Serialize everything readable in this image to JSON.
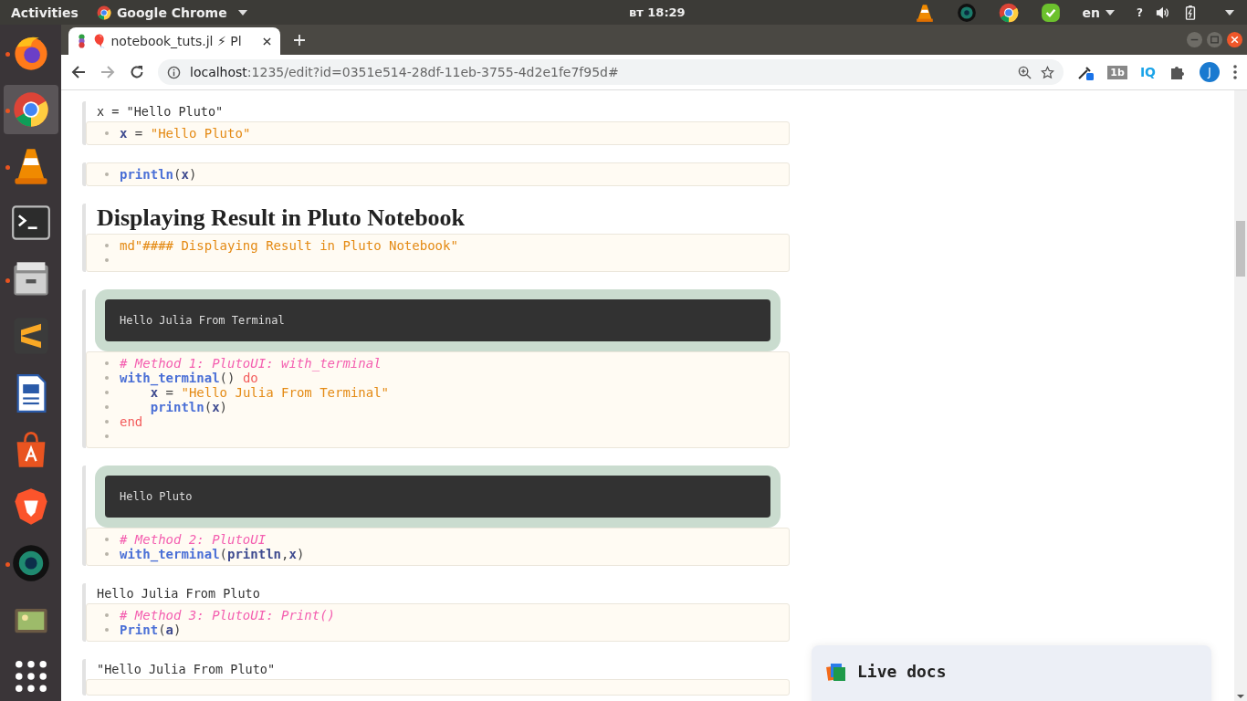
{
  "top_bar": {
    "activities": "Activities",
    "app_menu": "Google Chrome",
    "clock": "вт 18:29",
    "language": "en",
    "help": "?"
  },
  "dock": [
    {
      "kind": "firefox",
      "running": true,
      "selected": false
    },
    {
      "kind": "chrome",
      "running": true,
      "selected": true
    },
    {
      "kind": "vlc",
      "running": true,
      "selected": false
    },
    {
      "kind": "terminal",
      "running": false,
      "selected": false
    },
    {
      "kind": "files",
      "running": true,
      "selected": false
    },
    {
      "kind": "sublime",
      "running": false,
      "selected": false
    },
    {
      "kind": "writer",
      "running": false,
      "selected": false
    },
    {
      "kind": "store",
      "running": false,
      "selected": false
    },
    {
      "kind": "brave",
      "running": false,
      "selected": false
    },
    {
      "kind": "camera",
      "running": true,
      "selected": false
    },
    {
      "kind": "photos",
      "running": false,
      "selected": false
    },
    {
      "kind": "apps",
      "running": false,
      "selected": false
    }
  ],
  "browser": {
    "tab_title": "🎈 notebook_tuts.jl ⚡ Pl",
    "url_host": "localhost",
    "url_rest": ":1235/edit?id=0351e514-28df-11eb-3755-4d2e1fe7f95d#",
    "extension_labels": [
      "1b",
      "IQ"
    ],
    "avatar": "J"
  },
  "cells": [
    {
      "output": {
        "kind": "text",
        "text": "x = \"Hello Pluto\""
      },
      "lines": [
        {
          "kind": "code",
          "tokens": [
            {
              "text": "x",
              "kind": "var"
            },
            {
              "text": " = ",
              "kind": "op"
            },
            {
              "text": "\"Hello Pluto\"",
              "kind": "str"
            }
          ]
        }
      ]
    },
    {
      "output": {
        "kind": "none"
      },
      "lines": [
        {
          "kind": "code",
          "tokens": [
            {
              "text": "println",
              "kind": "func"
            },
            {
              "text": "(",
              "kind": "punc"
            },
            {
              "text": "x",
              "kind": "var"
            },
            {
              "text": ")",
              "kind": "punc"
            }
          ]
        }
      ]
    },
    {
      "output": {
        "kind": "heading",
        "text": "Displaying Result in Pluto Notebook"
      },
      "lines": [
        {
          "kind": "code",
          "tokens": [
            {
              "text": "md\"#### Displaying Result in Pluto Notebook\"",
              "kind": "str"
            }
          ]
        },
        {
          "kind": "blank"
        }
      ]
    },
    {
      "output": {
        "kind": "terminal",
        "text": "Hello Julia From Terminal"
      },
      "lines": [
        {
          "kind": "code",
          "tokens": [
            {
              "text": "# Method 1: PlutoUI: with_terminal",
              "kind": "comment"
            }
          ]
        },
        {
          "kind": "code",
          "tokens": [
            {
              "text": "with_terminal",
              "kind": "func"
            },
            {
              "text": "() ",
              "kind": "punc"
            },
            {
              "text": "do",
              "kind": "kw"
            }
          ]
        },
        {
          "kind": "code",
          "tokens": [
            {
              "text": "    x",
              "kind": "var"
            },
            {
              "text": " = ",
              "kind": "op"
            },
            {
              "text": "\"Hello Julia From Terminal\"",
              "kind": "str"
            }
          ]
        },
        {
          "kind": "code",
          "tokens": [
            {
              "text": "    println",
              "kind": "func"
            },
            {
              "text": "(",
              "kind": "punc"
            },
            {
              "text": "x",
              "kind": "var"
            },
            {
              "text": ")",
              "kind": "punc"
            }
          ]
        },
        {
          "kind": "code",
          "tokens": [
            {
              "text": "end",
              "kind": "kw"
            }
          ]
        },
        {
          "kind": "blank"
        }
      ]
    },
    {
      "output": {
        "kind": "terminal",
        "text": "Hello Pluto"
      },
      "lines": [
        {
          "kind": "code",
          "tokens": [
            {
              "text": "# Method 2: PlutoUI",
              "kind": "comment"
            }
          ]
        },
        {
          "kind": "code",
          "tokens": [
            {
              "text": "with_terminal",
              "kind": "func"
            },
            {
              "text": "(",
              "kind": "punc"
            },
            {
              "text": "println",
              "kind": "var"
            },
            {
              "text": ",",
              "kind": "punc"
            },
            {
              "text": "x",
              "kind": "var"
            },
            {
              "text": ")",
              "kind": "punc"
            }
          ]
        }
      ]
    },
    {
      "output": {
        "kind": "text",
        "text": "Hello Julia From Pluto"
      },
      "lines": [
        {
          "kind": "code",
          "tokens": [
            {
              "text": "# Method 3: PlutoUI: Print()",
              "kind": "comment"
            }
          ]
        },
        {
          "kind": "code",
          "tokens": [
            {
              "text": "Print",
              "kind": "func"
            },
            {
              "text": "(",
              "kind": "punc"
            },
            {
              "text": "a",
              "kind": "var"
            },
            {
              "text": ")",
              "kind": "punc"
            }
          ]
        }
      ]
    },
    {
      "output": {
        "kind": "text",
        "text": "\"Hello Julia From Pluto\""
      }
    }
  ],
  "live_docs": {
    "title": "Live docs"
  }
}
